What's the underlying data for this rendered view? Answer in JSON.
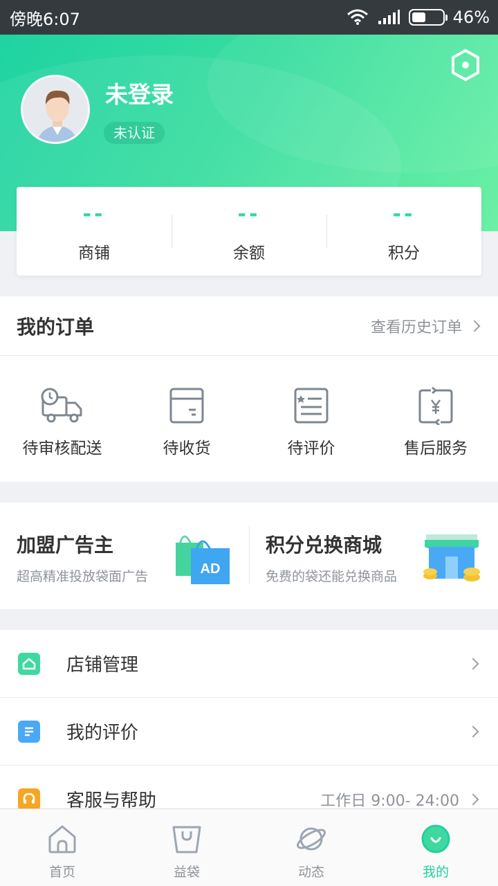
{
  "status_bar": {
    "time": "傍晚6:07",
    "battery": "46%",
    "battery_level": 0.46
  },
  "profile": {
    "name": "未登录",
    "badge": "未认证"
  },
  "stats": [
    {
      "value": "--",
      "label": "商铺"
    },
    {
      "value": "--",
      "label": "余额"
    },
    {
      "value": "--",
      "label": "积分"
    }
  ],
  "orders": {
    "title": "我的订单",
    "history_link": "查看历史订单",
    "items": [
      {
        "label": "待审核配送",
        "icon": "delivery-truck-icon"
      },
      {
        "label": "待收货",
        "icon": "package-box-icon"
      },
      {
        "label": "待评价",
        "icon": "review-form-icon"
      },
      {
        "label": "售后服务",
        "icon": "refund-yuan-icon"
      }
    ]
  },
  "promos": [
    {
      "title": "加盟广告主",
      "subtitle": "超高精准投放袋面广告",
      "image": "ad-shopping-bags",
      "image_text": "AD"
    },
    {
      "title": "积分兑换商城",
      "subtitle": "免费的袋还能兑换商品",
      "image": "store-with-coins"
    }
  ],
  "menu": [
    {
      "label": "店铺管理",
      "icon": "store-home-icon",
      "color": "#3fd9a0",
      "extra": ""
    },
    {
      "label": "我的评价",
      "icon": "review-list-icon",
      "color": "#4aa9f5",
      "extra": ""
    },
    {
      "label": "客服与帮助",
      "icon": "headset-icon",
      "color": "#f6a623",
      "extra": "工作日 9:00- 24:00"
    }
  ],
  "tabs": [
    {
      "label": "首页",
      "icon": "home-icon",
      "active": false
    },
    {
      "label": "益袋",
      "icon": "bag-icon",
      "active": false
    },
    {
      "label": "动态",
      "icon": "planet-icon",
      "active": false
    },
    {
      "label": "我的",
      "icon": "smile-profile-icon",
      "active": true
    }
  ],
  "colors": {
    "accent": "#22cfa0",
    "status_bar": "#353a3e"
  }
}
